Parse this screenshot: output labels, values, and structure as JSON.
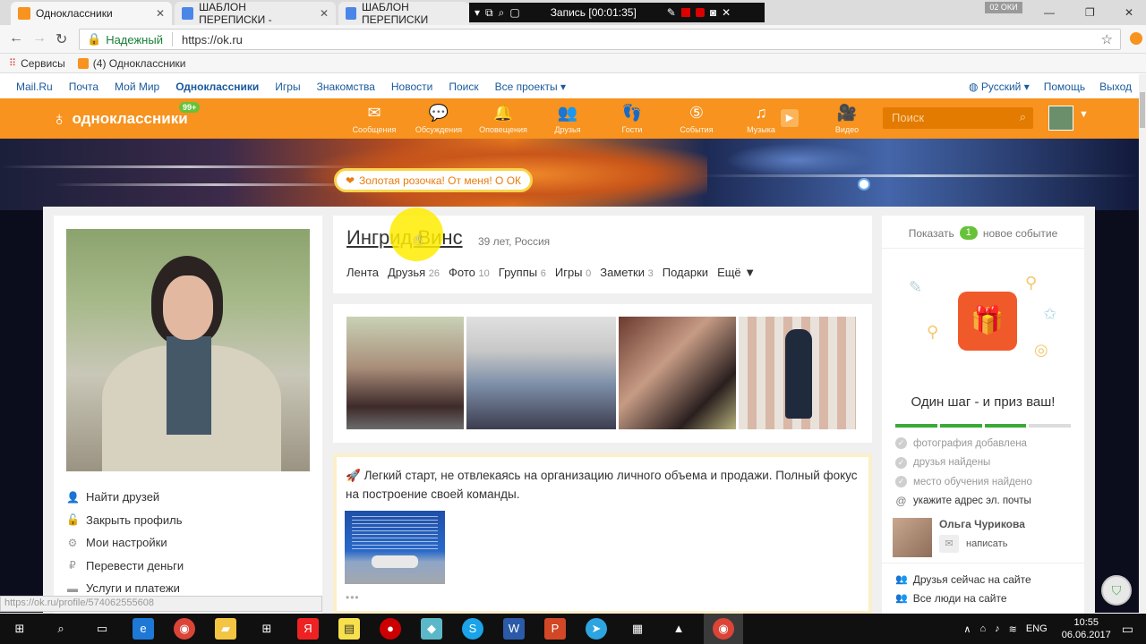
{
  "browser": {
    "tabs": [
      {
        "label": "Одноклассники",
        "active": true
      },
      {
        "label": "ШАБЛОН ПЕРЕПИСКИ -",
        "active": false
      },
      {
        "label": "ШАБЛОН ПЕРЕПИСКИ",
        "active": false
      }
    ],
    "recording": "Запись [00:01:35]",
    "user_chip": "02 ОКИ",
    "secure_label": "Надежный",
    "url": "https://ok.ru",
    "bookmarks": [
      "Сервисы",
      "(4) Одноклассники"
    ],
    "status_url": "https://ok.ru/profile/574062555608"
  },
  "portal_nav": {
    "links": [
      "Mail.Ru",
      "Почта",
      "Мой Мир",
      "Одноклассники",
      "Игры",
      "Знакомства",
      "Новости",
      "Поиск",
      "Все проекты"
    ],
    "language": "Русский",
    "help": "Помощь",
    "logout": "Выход"
  },
  "toolbar": {
    "logo": "одноклассники",
    "badge": "99+",
    "nav": [
      {
        "label": "Сообщения",
        "icon": "envelope-icon"
      },
      {
        "label": "Обсуждения",
        "icon": "chat-icon"
      },
      {
        "label": "Оповещения",
        "icon": "bell-icon"
      },
      {
        "label": "Друзья",
        "icon": "friends-icon"
      },
      {
        "label": "Гости",
        "icon": "footprints-icon"
      },
      {
        "label": "События",
        "icon": "events-icon"
      },
      {
        "label": "Музыка",
        "icon": "music-icon"
      },
      {
        "label": "Видео",
        "icon": "video-icon"
      }
    ],
    "search_placeholder": "Поиск"
  },
  "banner": {
    "gold_rose": "Золотая розочка! От меня! О ОК"
  },
  "profile": {
    "name": "Ингрид Винс",
    "meta": "39 лет, Россия",
    "tabs": [
      {
        "label": "Лента",
        "count": ""
      },
      {
        "label": "Друзья",
        "count": "26"
      },
      {
        "label": "Фото",
        "count": "10"
      },
      {
        "label": "Группы",
        "count": "6"
      },
      {
        "label": "Игры",
        "count": "0"
      },
      {
        "label": "Заметки",
        "count": "3"
      },
      {
        "label": "Подарки",
        "count": ""
      },
      {
        "label": "Ещё ▼",
        "count": ""
      }
    ]
  },
  "side_menu": [
    {
      "label": "Найти друзей",
      "icon": "person-icon"
    },
    {
      "label": "Закрыть профиль",
      "icon": "lock-icon"
    },
    {
      "label": "Мои настройки",
      "icon": "gear-icon"
    },
    {
      "label": "Перевести деньги",
      "icon": "money-icon"
    },
    {
      "label": "Услуги и платежи",
      "icon": "card-icon"
    }
  ],
  "post": {
    "text": "Легкий старт, не отвлекаясь на организацию личного объема и продажи. Полный фокус на построение своей команды.",
    "more": "•••"
  },
  "right_panel": {
    "show_prefix": "Показать",
    "show_count": "1",
    "show_suffix": "новое событие",
    "title": "Один шаг - и приз ваш!",
    "progress": {
      "done": 3,
      "total": 4
    },
    "steps": [
      {
        "label": "фотография добавлена",
        "done": true
      },
      {
        "label": "друзья найдены",
        "done": true
      },
      {
        "label": "место обучения найдено",
        "done": true
      },
      {
        "label": "укажите адрес эл. почты",
        "done": false
      }
    ],
    "friend_name": "Ольга Чурикова",
    "write_label": "написать",
    "online_friends": "Друзья сейчас на сайте",
    "all_people": "Все люди на сайте"
  },
  "taskbar": {
    "time": "10:55",
    "date": "06.06.2017",
    "lang": "ENG"
  }
}
